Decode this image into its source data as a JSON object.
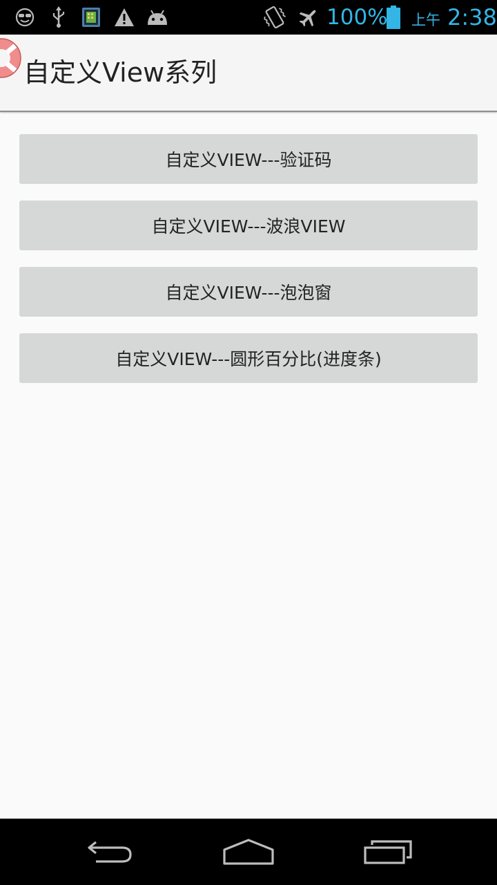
{
  "status_bar": {
    "left_icons": [
      "sunglasses-face-icon",
      "usb-icon",
      "sim-toolkit-icon",
      "warning-icon",
      "android-icon"
    ],
    "right_icons": [
      "vibrate-icon",
      "airplane-mode-icon",
      "battery-icon"
    ],
    "battery_percent": "100%",
    "ampm": "上午",
    "time": "2:38",
    "accent_color": "#33b5e5"
  },
  "action_bar": {
    "logo_icon": "life-ring-icon",
    "title": "自定义View系列"
  },
  "buttons": [
    {
      "label": "自定义VIEW---验证码"
    },
    {
      "label": "自定义VIEW---波浪VIEW"
    },
    {
      "label": "自定义VIEW---泡泡窗"
    },
    {
      "label": "自定义VIEW---圆形百分比(进度条)"
    }
  ],
  "nav_bar": {
    "items": [
      "back-icon",
      "home-icon",
      "recent-apps-icon"
    ]
  }
}
